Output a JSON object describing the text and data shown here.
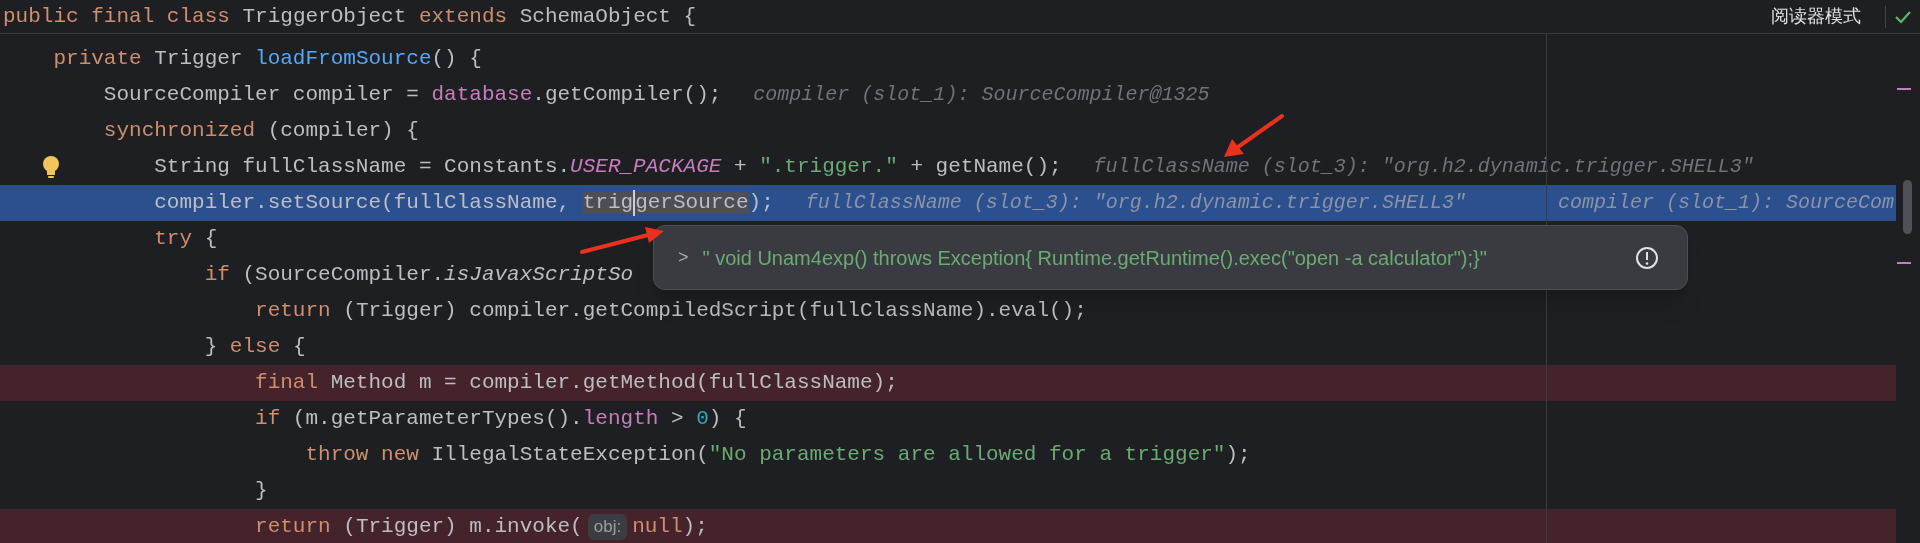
{
  "header": {
    "tokens": [
      {
        "text": "public",
        "kind": "keyword"
      },
      {
        "text": " final",
        "kind": "keyword"
      },
      {
        "text": " class",
        "kind": "keyword"
      },
      {
        "text": " TriggerObject ",
        "kind": "plain"
      },
      {
        "text": "extends",
        "kind": "keyword"
      },
      {
        "text": " SchemaObject {",
        "kind": "plain"
      }
    ]
  },
  "reader_mode_button": "阅读器模式",
  "lines": [
    {
      "kind": "normal",
      "tokens": [
        {
          "text": "    private",
          "kind": "keyword"
        },
        {
          "text": " Trigger ",
          "kind": "plain"
        },
        {
          "text": "loadFromSource",
          "kind": "decl"
        },
        {
          "text": "() {",
          "kind": "plain"
        }
      ]
    },
    {
      "kind": "normal",
      "tokens": [
        {
          "text": "        SourceCompiler compiler = ",
          "kind": "plain"
        },
        {
          "text": "database",
          "kind": "field"
        },
        {
          "text": ".getCompiler();",
          "kind": "plain"
        }
      ],
      "hints": [
        "compiler (slot_1): SourceCompiler@1325"
      ]
    },
    {
      "kind": "normal",
      "tokens": [
        {
          "text": "        synchronized",
          "kind": "keyword"
        },
        {
          "text": " (compiler) {",
          "kind": "plain"
        }
      ]
    },
    {
      "kind": "normal",
      "bulb": true,
      "tokens": [
        {
          "text": "            String fullClassName = Constants.",
          "kind": "plain"
        },
        {
          "text": "USER_PACKAGE",
          "kind": "constant"
        },
        {
          "text": " + ",
          "kind": "plain"
        },
        {
          "text": "\".trigger.\"",
          "kind": "string"
        },
        {
          "text": " + getName();",
          "kind": "plain"
        }
      ],
      "hints": [
        "fullClassName (slot_3): \"org.h2.dynamic.trigger.SHELL3\""
      ]
    },
    {
      "kind": "current",
      "tokens": [
        {
          "text": "            compiler.setSource(fullClassName, ",
          "kind": "plain"
        },
        {
          "text": "trig",
          "kind": "usage",
          "caret": true
        },
        {
          "text": "gerSource",
          "kind": "usage"
        },
        {
          "text": ");",
          "kind": "plain"
        }
      ],
      "hints": [
        "fullClassName (slot_3): \"org.h2.dynamic.trigger.SHELL3\"",
        "compiler (slot_1): SourceCom"
      ]
    },
    {
      "kind": "normal",
      "tokens": [
        {
          "text": "            try",
          "kind": "keyword"
        },
        {
          "text": " {",
          "kind": "plain"
        }
      ]
    },
    {
      "kind": "normal",
      "tokens": [
        {
          "text": "                if",
          "kind": "keyword"
        },
        {
          "text": " (SourceCompiler.",
          "kind": "plain"
        },
        {
          "text": "isJavaxScriptSo",
          "kind": "static_call"
        }
      ]
    },
    {
      "kind": "normal",
      "tokens": [
        {
          "text": "                    return",
          "kind": "keyword"
        },
        {
          "text": " (Trigger) compiler.getCompiledScript(fullClassName).eval();",
          "kind": "plain"
        }
      ]
    },
    {
      "kind": "normal",
      "tokens": [
        {
          "text": "                } ",
          "kind": "plain"
        },
        {
          "text": "else",
          "kind": "keyword"
        },
        {
          "text": " {",
          "kind": "plain"
        }
      ]
    },
    {
      "kind": "error",
      "tokens": [
        {
          "text": "                    final",
          "kind": "keyword"
        },
        {
          "text": " Method m = compiler.getMethod(fullClassName);",
          "kind": "plain"
        }
      ]
    },
    {
      "kind": "normal",
      "tokens": [
        {
          "text": "                    if",
          "kind": "keyword"
        },
        {
          "text": " (m.getParameterTypes().",
          "kind": "plain"
        },
        {
          "text": "length",
          "kind": "field"
        },
        {
          "text": " > ",
          "kind": "plain"
        },
        {
          "text": "0",
          "kind": "number"
        },
        {
          "text": ") {",
          "kind": "plain"
        }
      ]
    },
    {
      "kind": "normal",
      "tokens": [
        {
          "text": "                        throw",
          "kind": "keyword"
        },
        {
          "text": " new",
          "kind": "keyword"
        },
        {
          "text": " IllegalStateException(",
          "kind": "plain"
        },
        {
          "text": "\"No parameters are allowed for a trigger\"",
          "kind": "string"
        },
        {
          "text": ");",
          "kind": "plain"
        }
      ]
    },
    {
      "kind": "normal",
      "tokens": [
        {
          "text": "                    }",
          "kind": "plain"
        }
      ]
    },
    {
      "kind": "error",
      "tokens": [
        {
          "text": "                    return",
          "kind": "keyword"
        },
        {
          "text": " (Trigger) m.invoke(",
          "kind": "plain"
        },
        {
          "text": "obj:",
          "kind": "param_hint"
        },
        {
          "text": "null",
          "kind": "keyword"
        },
        {
          "text": ");",
          "kind": "plain"
        }
      ]
    }
  ],
  "popup": {
    "chevron": ">",
    "text": "\" void Unam4exp() throws Exception{ Runtime.getRuntime().exec(\"open -a calculator\");}\""
  }
}
